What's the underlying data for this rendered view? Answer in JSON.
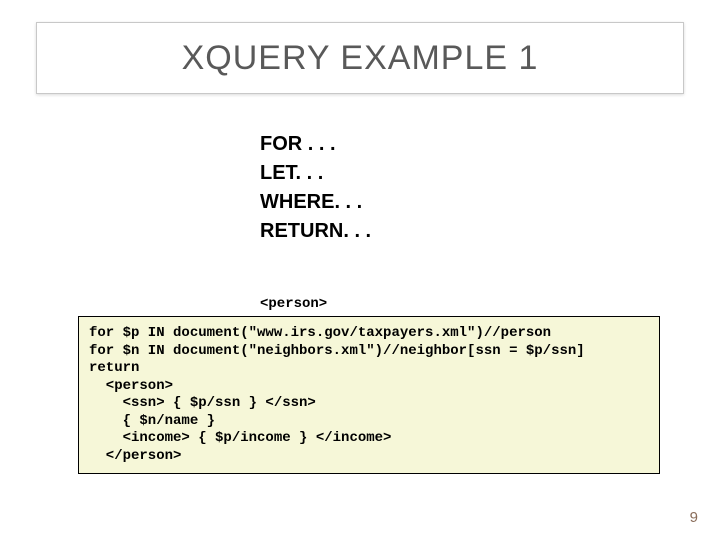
{
  "title": "XQUERY EXAMPLE 1",
  "flwor": {
    "l1": "FOR . . .",
    "l2": "LET. . .",
    "l3": "WHERE. . .",
    "l4": "RETURN. . ."
  },
  "snippet_label": "<person>",
  "code": {
    "l1": "for $p IN document(\"www.irs.gov/taxpayers.xml\")//person",
    "l2": "for $n IN document(\"neighbors.xml\")//neighbor[ssn = $p/ssn]",
    "l3": "return",
    "l4": "  <person>",
    "l5": "    <ssn> { $p/ssn } </ssn>",
    "l6": "    { $n/name }",
    "l7": "    <income> { $p/income } </income>",
    "l8": "  </person>"
  },
  "page_number": "9"
}
